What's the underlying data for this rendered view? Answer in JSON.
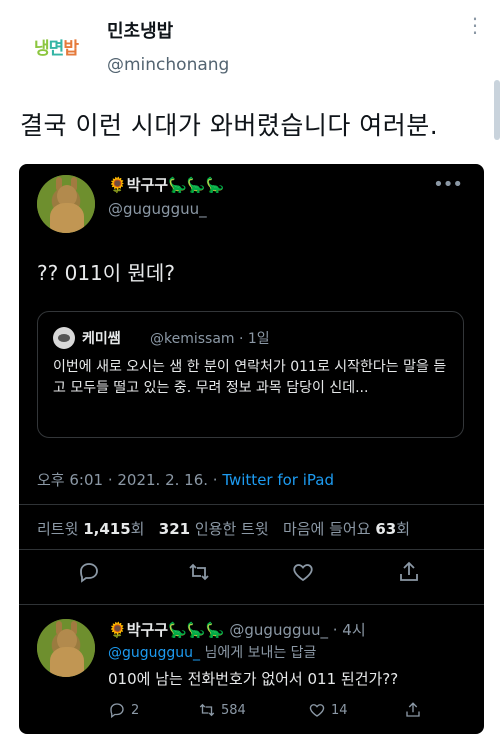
{
  "outer": {
    "logo": [
      "냉",
      "면",
      "밥"
    ],
    "name": "민초냉밥",
    "handle": "@minchonang",
    "text": "결국 이런 시대가 와버렸습니다 여러분.",
    "more": "⋮"
  },
  "tweet": {
    "name": "박구구",
    "handle": "@gugugguu_",
    "more": "•••",
    "text": "?? 011이 뭔데?",
    "quote": {
      "name": "케미쌤",
      "handle": "@kemissam · 1일",
      "body": "이번에 새로 오시는 샘 한 분이 연락처가 011로 시작한다는 말을 듣고 모두들 떨고 있는 중. 무려 정보 과목 담당이 신데..."
    },
    "time": "오후 6:01 · 2021. 2. 16. · ",
    "source": "Twitter for iPad",
    "stats": {
      "retweet_label": "리트윗",
      "retweet_count": "1,415",
      "retweet_unit": "회",
      "quote_count": "321",
      "quote_label": "인용한 트윗",
      "like_label": "마음에 들어요",
      "like_count": "63",
      "like_unit": "회"
    }
  },
  "reply": {
    "name": "박구구",
    "handle": "@gugugguu_ · 4시",
    "reply_to_link": "@gugugguu_",
    "reply_to_suffix": " 님에게 보내는 답글",
    "text": "010에 남는 전화번호가 없어서 011 된건가??",
    "replies": "2",
    "retweets": "584",
    "likes": "14"
  },
  "icons": {
    "flower": "🌻",
    "dino": "🦕"
  },
  "colors": {
    "accent": "#1d9bf0",
    "dark_bg": "#000000",
    "muted": "#8b98a5"
  }
}
